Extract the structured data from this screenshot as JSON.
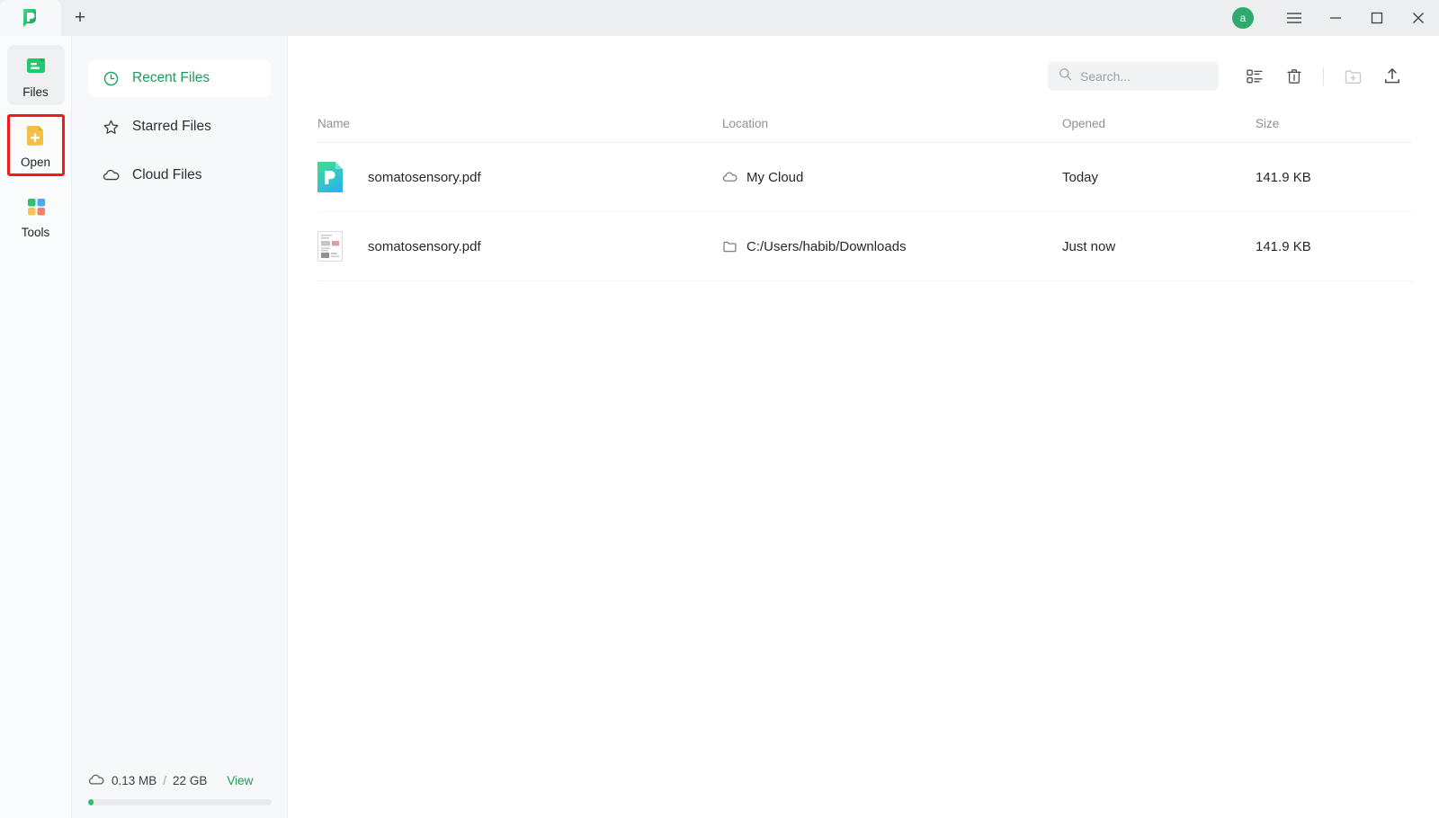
{
  "window": {
    "tab_icon": "app-logo-icon",
    "new_tab_label": "+",
    "avatar_initial": "a",
    "menu_icon": "hamburger-menu-icon",
    "minimize_icon": "minimize-icon",
    "maximize_icon": "maximize-icon",
    "close_icon": "close-icon",
    "accent_green": "#1a9c5c",
    "highlight_red": "#f21b1b"
  },
  "rail": {
    "items": [
      {
        "label": "Files",
        "icon": "files-icon",
        "selected": true,
        "highlighted": false
      },
      {
        "label": "Open",
        "icon": "open-file-icon",
        "selected": false,
        "highlighted": true
      },
      {
        "label": "Tools",
        "icon": "tools-grid-icon",
        "selected": false,
        "highlighted": false
      }
    ]
  },
  "nav": {
    "items": [
      {
        "label": "Recent Files",
        "icon": "clock-icon",
        "selected": true
      },
      {
        "label": "Starred Files",
        "icon": "star-icon",
        "selected": false
      },
      {
        "label": "Cloud Files",
        "icon": "cloud-icon",
        "selected": false
      }
    ],
    "storage": {
      "icon": "cloud-icon",
      "used": "0.13 MB",
      "separator": "/",
      "total": "22 GB",
      "view_label": "View",
      "percent": 3
    }
  },
  "toolbar": {
    "search_placeholder": "Search...",
    "search_value": "",
    "search_icon": "search-icon",
    "list_view_icon": "list-view-icon",
    "trash_icon": "trash-icon",
    "new_folder_icon": "new-folder-icon",
    "upload_icon": "upload-icon"
  },
  "table": {
    "headers": [
      "Name",
      "Location",
      "Opened",
      "Size"
    ],
    "rows": [
      {
        "name": "somatosensory.pdf",
        "file_icon": "pdf-gradient-icon",
        "location": "My Cloud",
        "location_icon": "cloud-icon",
        "opened": "Today",
        "size": "141.9 KB"
      },
      {
        "name": "somatosensory.pdf",
        "file_icon": "document-thumbnail-icon",
        "location": "C:/Users/habib/Downloads",
        "location_icon": "folder-icon",
        "opened": "Just now",
        "size": "141.9 KB"
      }
    ]
  }
}
